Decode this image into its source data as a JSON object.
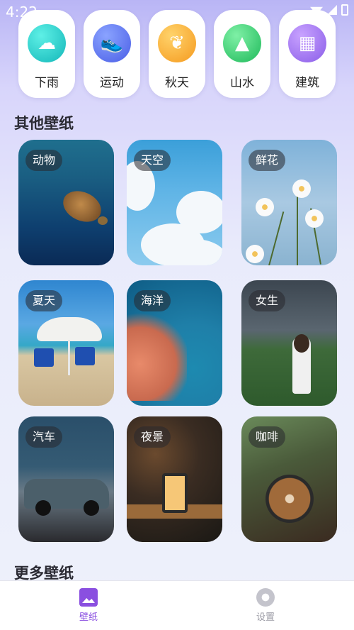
{
  "status_bar": {
    "time": "4:22"
  },
  "categories": [
    {
      "label": "下雨",
      "icon": "cloud-rain-icon"
    },
    {
      "label": "运动",
      "icon": "sneaker-icon"
    },
    {
      "label": "秋天",
      "icon": "maple-leaf-icon"
    },
    {
      "label": "山水",
      "icon": "mountain-water-icon"
    },
    {
      "label": "建筑",
      "icon": "building-icon"
    }
  ],
  "sections": {
    "other": "其他壁纸",
    "more": "更多壁纸"
  },
  "wallpapers": [
    {
      "tag": "动物"
    },
    {
      "tag": "天空"
    },
    {
      "tag": "鲜花"
    },
    {
      "tag": "夏天"
    },
    {
      "tag": "海洋"
    },
    {
      "tag": "女生"
    },
    {
      "tag": "汽车"
    },
    {
      "tag": "夜景"
    },
    {
      "tag": "咖啡"
    }
  ],
  "bottom_nav": [
    {
      "label": "壁纸",
      "icon": "picture-icon",
      "active": true
    },
    {
      "label": "设置",
      "icon": "gear-icon",
      "active": false
    }
  ],
  "colors": {
    "accent": "#8a4fe0",
    "inactive": "#9a9aa4"
  }
}
